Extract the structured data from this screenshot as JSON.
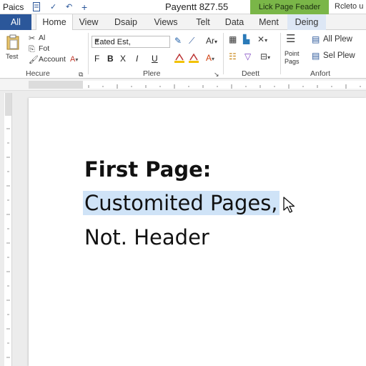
{
  "titlebar": {
    "app_name": "Paics",
    "quick_access": [
      "document-icon",
      "check-icon",
      "undo-icon",
      "add-icon"
    ],
    "doc_title": "Payentt 8Z7.55",
    "context_button": "Lick Page Feader",
    "right_text": "Rcleto u"
  },
  "tabs": [
    {
      "label": "All",
      "state": "file"
    },
    {
      "label": "Home",
      "state": "active"
    },
    {
      "label": "View",
      "state": "normal"
    },
    {
      "label": "Dsaip",
      "state": "normal"
    },
    {
      "label": "Views",
      "state": "normal"
    },
    {
      "label": "Telt",
      "state": "normal"
    },
    {
      "label": "Data",
      "state": "normal"
    },
    {
      "label": "Ment",
      "state": "normal"
    },
    {
      "label": "Deing",
      "state": "context"
    }
  ],
  "ribbon": {
    "group1": {
      "big_label": "Test",
      "items": [
        "Al",
        "Fot",
        "Account"
      ],
      "label": "Hecure"
    },
    "group2": {
      "font_name": "Eated Est,",
      "format_buttons": [
        "F",
        "B",
        "X",
        "I",
        "U"
      ],
      "label": "Plere"
    },
    "group3": {
      "label": "Deett"
    },
    "group4": {
      "big_label": "Point Pags",
      "items": [
        "All Plew",
        "Sel Plew"
      ],
      "label": "Anfort"
    }
  },
  "document": {
    "line1": "First Page:",
    "line2": "Customited Pages,",
    "line3": "Not. Header"
  },
  "colors": {
    "accent": "#2b579a",
    "context_green": "#7ab648",
    "selection": "#cfe3f7"
  }
}
